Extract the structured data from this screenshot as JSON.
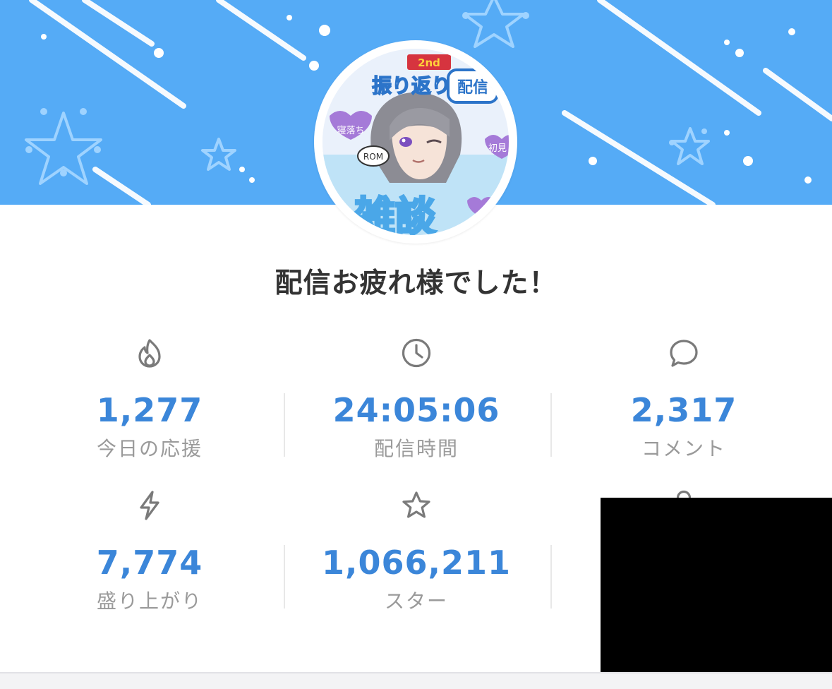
{
  "header": {
    "title": "配信お疲れ様でした！",
    "banner_color": "#55abf6",
    "avatar_icon": "streamer-avatar"
  },
  "stats": [
    {
      "icon": "flame-icon",
      "value": "1,277",
      "label": "今日の応援"
    },
    {
      "icon": "clock-icon",
      "value": "24:05:06",
      "label": "配信時間"
    },
    {
      "icon": "comment-icon",
      "value": "2,317",
      "label": "コメント"
    },
    {
      "icon": "lightning-icon",
      "value": "7,774",
      "label": "盛り上がり"
    },
    {
      "icon": "star-icon",
      "value": "1,066,211",
      "label": "スター"
    },
    {
      "icon": "person-icon",
      "value": "",
      "label": ""
    }
  ],
  "colors": {
    "value": "#3b86d9",
    "label": "#9a9a9a",
    "title": "#333333"
  }
}
